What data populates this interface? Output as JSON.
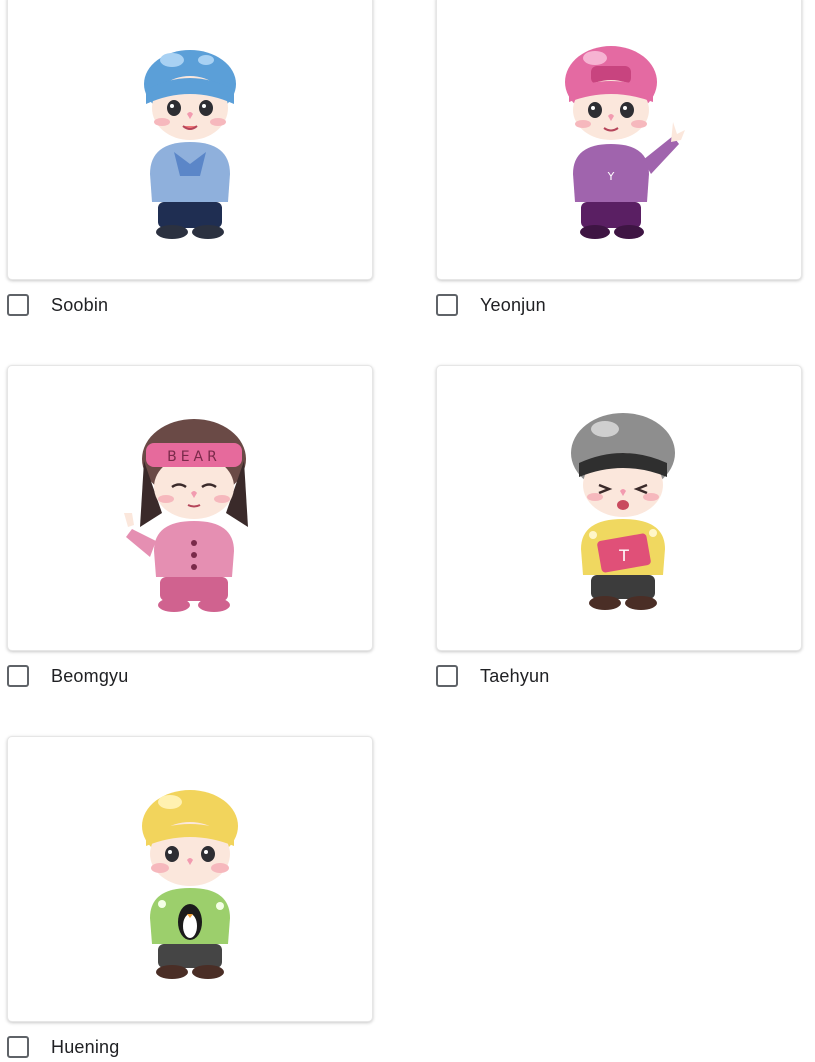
{
  "options": [
    {
      "label": "Soobin",
      "checked": false,
      "image_icon": "chibi-blue-hair-icon",
      "hair_color": "#5b9fd8",
      "top_color": "#8fb0dc",
      "pants_color": "#1f2e52"
    },
    {
      "label": "Yeonjun",
      "checked": false,
      "image_icon": "chibi-pink-hair-icon",
      "hair_color": "#e46aa2",
      "top_color": "#a064ad",
      "pants_color": "#5a1f63"
    },
    {
      "label": "Beomgyu",
      "checked": false,
      "image_icon": "chibi-brown-hair-icon",
      "hair_color": "#6a4a46",
      "top_color": "#e58fb2",
      "pants_color": "#d0628f",
      "sleep_mask_text": "BEAR"
    },
    {
      "label": "Taehyun",
      "checked": false,
      "image_icon": "chibi-silver-hair-icon",
      "hair_color": "#8e8e8e",
      "top_color": "#f0d860",
      "pants_color": "#3c3c3c",
      "pillow_text": "T"
    },
    {
      "label": "Huening",
      "checked": false,
      "image_icon": "chibi-blonde-hair-icon",
      "hair_color": "#f2d45c",
      "top_color": "#9ccf6c",
      "pants_color": "#454545"
    }
  ]
}
